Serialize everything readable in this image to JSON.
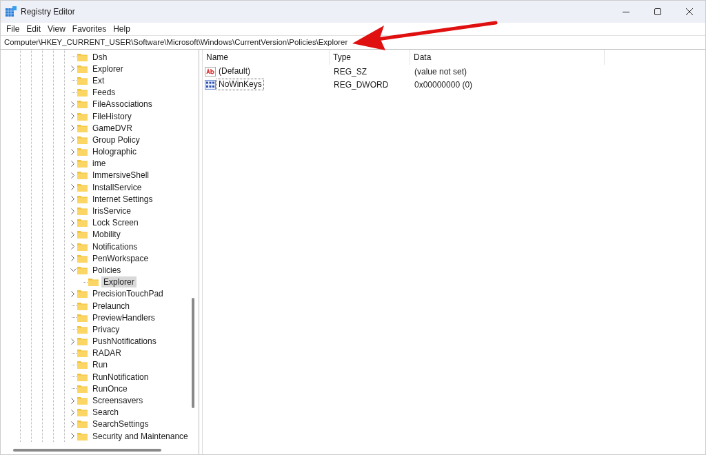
{
  "window": {
    "title": "Registry Editor"
  },
  "menu": [
    "File",
    "Edit",
    "View",
    "Favorites",
    "Help"
  ],
  "address": "Computer\\HKEY_CURRENT_USER\\Software\\Microsoft\\Windows\\CurrentVersion\\Policies\\Explorer",
  "tree": {
    "items": [
      {
        "label": "Dsh",
        "has_children": false,
        "expanded": false,
        "selected": false
      },
      {
        "label": "Explorer",
        "has_children": true,
        "expanded": false,
        "selected": false
      },
      {
        "label": "Ext",
        "has_children": false,
        "expanded": false,
        "selected": false
      },
      {
        "label": "Feeds",
        "has_children": false,
        "expanded": false,
        "selected": false
      },
      {
        "label": "FileAssociations",
        "has_children": true,
        "expanded": false,
        "selected": false
      },
      {
        "label": "FileHistory",
        "has_children": true,
        "expanded": false,
        "selected": false
      },
      {
        "label": "GameDVR",
        "has_children": true,
        "expanded": false,
        "selected": false
      },
      {
        "label": "Group Policy",
        "has_children": true,
        "expanded": false,
        "selected": false
      },
      {
        "label": "Holographic",
        "has_children": true,
        "expanded": false,
        "selected": false
      },
      {
        "label": "ime",
        "has_children": true,
        "expanded": false,
        "selected": false
      },
      {
        "label": "ImmersiveShell",
        "has_children": true,
        "expanded": false,
        "selected": false
      },
      {
        "label": "InstallService",
        "has_children": true,
        "expanded": false,
        "selected": false
      },
      {
        "label": "Internet Settings",
        "has_children": true,
        "expanded": false,
        "selected": false
      },
      {
        "label": "IrisService",
        "has_children": true,
        "expanded": false,
        "selected": false
      },
      {
        "label": "Lock Screen",
        "has_children": true,
        "expanded": false,
        "selected": false
      },
      {
        "label": "Mobility",
        "has_children": true,
        "expanded": false,
        "selected": false
      },
      {
        "label": "Notifications",
        "has_children": true,
        "expanded": false,
        "selected": false
      },
      {
        "label": "PenWorkspace",
        "has_children": true,
        "expanded": false,
        "selected": false
      },
      {
        "label": "Policies",
        "has_children": true,
        "expanded": true,
        "selected": false,
        "children": [
          {
            "label": "Explorer",
            "has_children": false,
            "expanded": false,
            "selected": true
          }
        ]
      },
      {
        "label": "PrecisionTouchPad",
        "has_children": true,
        "expanded": false,
        "selected": false
      },
      {
        "label": "Prelaunch",
        "has_children": false,
        "expanded": false,
        "selected": false
      },
      {
        "label": "PreviewHandlers",
        "has_children": false,
        "expanded": false,
        "selected": false
      },
      {
        "label": "Privacy",
        "has_children": false,
        "expanded": false,
        "selected": false
      },
      {
        "label": "PushNotifications",
        "has_children": true,
        "expanded": false,
        "selected": false
      },
      {
        "label": "RADAR",
        "has_children": false,
        "expanded": false,
        "selected": false
      },
      {
        "label": "Run",
        "has_children": false,
        "expanded": false,
        "selected": false
      },
      {
        "label": "RunNotification",
        "has_children": false,
        "expanded": false,
        "selected": false
      },
      {
        "label": "RunOnce",
        "has_children": false,
        "expanded": false,
        "selected": false
      },
      {
        "label": "Screensavers",
        "has_children": true,
        "expanded": false,
        "selected": false
      },
      {
        "label": "Search",
        "has_children": true,
        "expanded": false,
        "selected": false
      },
      {
        "label": "SearchSettings",
        "has_children": true,
        "expanded": false,
        "selected": false
      },
      {
        "label": "Security and Maintenance",
        "has_children": true,
        "expanded": false,
        "selected": false
      }
    ]
  },
  "values": {
    "columns": [
      "Name",
      "Type",
      "Data"
    ],
    "rows": [
      {
        "kind": "string",
        "name": "(Default)",
        "type": "REG_SZ",
        "data": "(value not set)",
        "focused": false
      },
      {
        "kind": "dword",
        "name": "NoWinKeys",
        "type": "REG_DWORD",
        "data": "0x00000000 (0)",
        "focused": true
      }
    ]
  }
}
